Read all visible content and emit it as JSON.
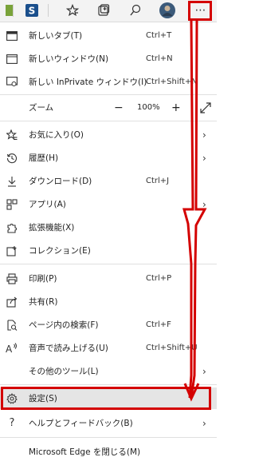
{
  "toolbar": {
    "icons": [
      "s-app-icon",
      "favorites-star-icon",
      "collections-icon",
      "feedback-icon",
      "profile-avatar",
      "more-menu-icon"
    ],
    "more_label": "⋯"
  },
  "menu": {
    "new_tab": {
      "label": "新しいタブ(T)",
      "shortcut": "Ctrl+T"
    },
    "new_window": {
      "label": "新しいウィンドウ(N)",
      "shortcut": "Ctrl+N"
    },
    "new_private": {
      "label": "新しい InPrivate ウィンドウ(I)",
      "shortcut": "Ctrl+Shift+N"
    },
    "zoom": {
      "label": "ズーム",
      "minus": "−",
      "value": "100%",
      "plus": "+"
    },
    "favorites": {
      "label": "お気に入り(O)"
    },
    "history": {
      "label": "履歴(H)"
    },
    "downloads": {
      "label": "ダウンロード(D)",
      "shortcut": "Ctrl+J"
    },
    "apps": {
      "label": "アプリ(A)"
    },
    "extensions": {
      "label": "拡張機能(X)"
    },
    "collections": {
      "label": "コレクション(E)"
    },
    "print": {
      "label": "印刷(P)",
      "shortcut": "Ctrl+P"
    },
    "share": {
      "label": "共有(R)"
    },
    "find": {
      "label": "ページ内の検索(F)",
      "shortcut": "Ctrl+F"
    },
    "read_aloud": {
      "label": "音声で読み上げる(U)",
      "shortcut": "Ctrl+Shift+U"
    },
    "more_tools": {
      "label": "その他のツール(L)"
    },
    "settings": {
      "label": "設定(S)"
    },
    "help": {
      "label": "ヘルプとフィードバック(B)"
    },
    "close": {
      "label": "Microsoft Edge を閉じる(M)"
    }
  },
  "colors": {
    "accent_red": "#d40000",
    "highlight": "#e5e5e5"
  }
}
